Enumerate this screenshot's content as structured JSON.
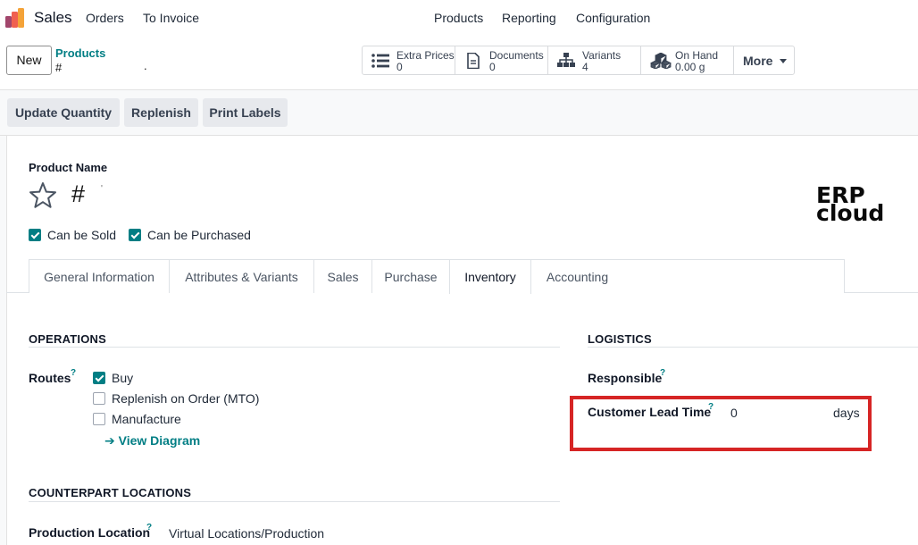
{
  "navbar": {
    "app_name": "Sales",
    "app_icon": "odoo-sales-app-icon",
    "left_menu": [
      "Orders",
      "To Invoice"
    ],
    "right_menu": [
      "Products",
      "Reporting",
      "Configuration"
    ]
  },
  "control_panel": {
    "new_label": "New",
    "breadcrumb_parent": "Products",
    "breadcrumb_current": "#",
    "stat_buttons": [
      {
        "label": "Extra Prices",
        "value": "0",
        "icon": "list-icon"
      },
      {
        "label": "Documents",
        "value": "0",
        "icon": "document-icon"
      },
      {
        "label": "Variants",
        "value": "4",
        "icon": "sitemap-icon"
      },
      {
        "label": "On Hand",
        "value": "0.00 g",
        "icon": "cubes-icon"
      }
    ],
    "more_label": "More"
  },
  "action_bar": {
    "buttons": [
      "Update Quantity",
      "Replenish",
      "Print Labels"
    ]
  },
  "product": {
    "name_label": "Product Name",
    "name_value": "#",
    "name_tick": "'",
    "can_be_sold_label": "Can be Sold",
    "can_be_sold": true,
    "can_be_purchased_label": "Can be Purchased",
    "can_be_purchased": true
  },
  "logo": {
    "line1": "ERP",
    "line2": "cloud"
  },
  "tabs": {
    "items": [
      "General Information",
      "Attributes & Variants",
      "Sales",
      "Purchase",
      "Inventory",
      "Accounting"
    ],
    "active": "Inventory"
  },
  "operations": {
    "title": "OPERATIONS",
    "routes_label": "Routes",
    "routes_help": "?",
    "routes": [
      {
        "label": "Buy",
        "checked": true
      },
      {
        "label": "Replenish on Order (MTO)",
        "checked": false
      },
      {
        "label": "Manufacture",
        "checked": false
      }
    ],
    "view_diagram_label": "View Diagram"
  },
  "logistics": {
    "title": "LOGISTICS",
    "responsible_label": "Responsible",
    "responsible_help": "?",
    "lead_time_label": "Customer Lead Time",
    "lead_time_help": "?",
    "lead_time_value": "0",
    "lead_time_unit": "days"
  },
  "counterpart": {
    "title": "COUNTERPART LOCATIONS",
    "production_label": "Production Location",
    "production_help": "?",
    "production_value": "Virtual Locations/Production"
  },
  "colors": {
    "accent": "#017e84",
    "highlight": "#d62525"
  }
}
